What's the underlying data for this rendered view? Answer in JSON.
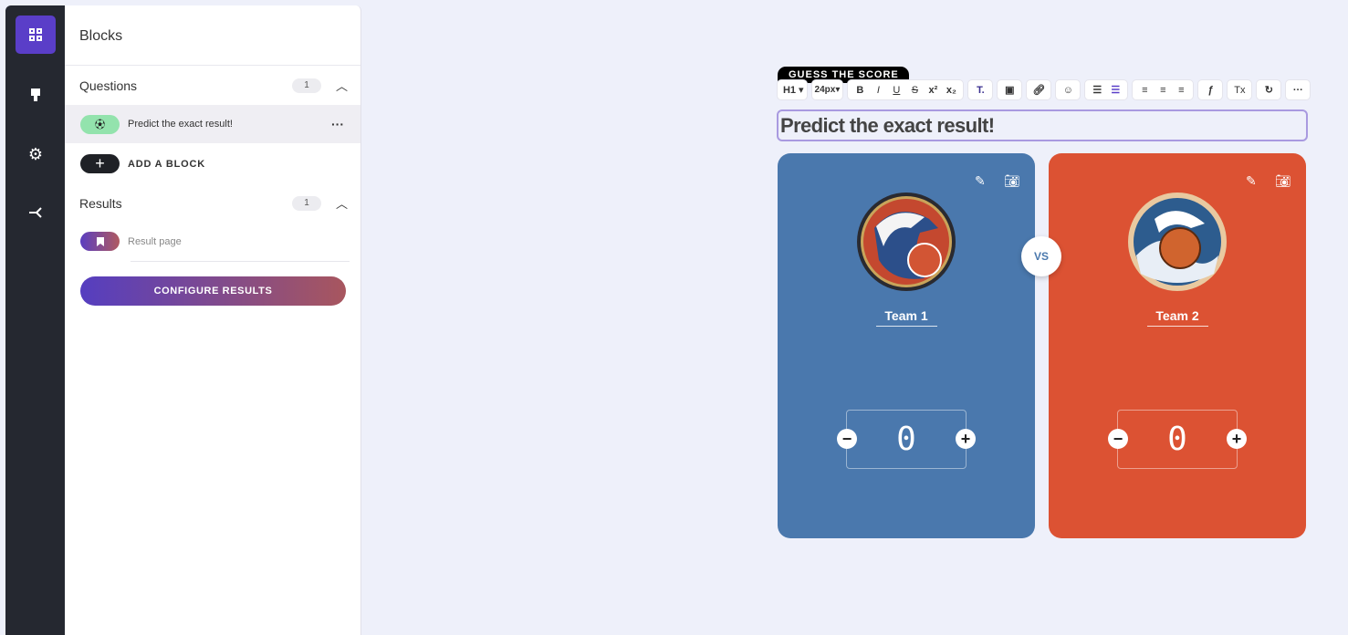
{
  "sidebar_rail": {
    "items": [
      {
        "icon": "grid-icon",
        "active": true
      },
      {
        "icon": "paint-brush-icon"
      },
      {
        "icon": "gear-icon"
      },
      {
        "icon": "share-flow-icon"
      }
    ]
  },
  "panel": {
    "title": "Blocks",
    "questions": {
      "label": "Questions",
      "count": "1",
      "items": [
        {
          "label": "Predict the exact result!",
          "icon": "soccer-ball-icon",
          "color": "#93e3ad"
        }
      ]
    },
    "add_block": "ADD A BLOCK",
    "results": {
      "label": "Results",
      "count": "1",
      "items": [
        {
          "label": "Result page",
          "icon": "bookmark-icon"
        }
      ]
    },
    "configure": "CONFIGURE RESULTS"
  },
  "editor": {
    "badge": "GUESS THE SCORE",
    "toolbar": {
      "heading": "H1",
      "font_size": "24px",
      "bold": "B",
      "italic": "I",
      "underline": "U",
      "strike": "S",
      "sup": "x²",
      "sub": "x₂",
      "clear": "Tx",
      "more": "···"
    },
    "title": "Predict the exact result!",
    "vs": "VS",
    "teams": [
      {
        "name": "Team 1",
        "score": "0",
        "color": "#4a78ad"
      },
      {
        "name": "Team 2",
        "score": "0",
        "color": "#dc5233"
      }
    ]
  }
}
